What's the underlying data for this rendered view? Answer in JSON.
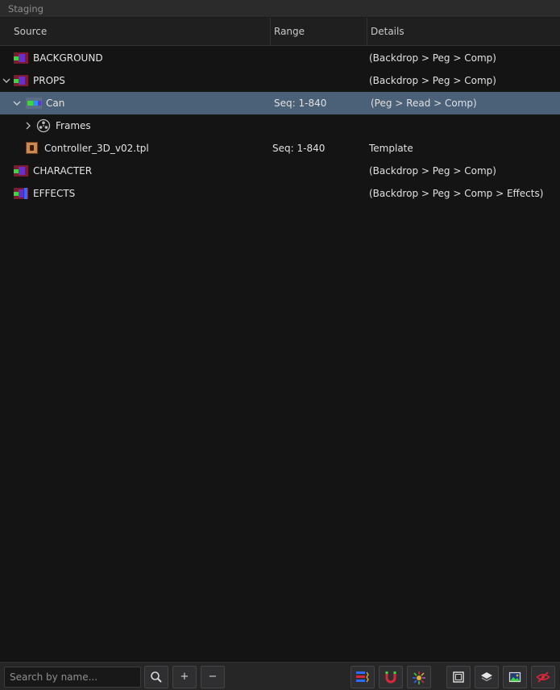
{
  "panel": {
    "title": "Staging"
  },
  "columns": {
    "source": "Source",
    "range": "Range",
    "details": "Details"
  },
  "rows": [
    {
      "name": "BACKGROUND",
      "range": "",
      "details": "(Backdrop > Peg > Comp)"
    },
    {
      "name": "PROPS",
      "range": "",
      "details": "(Backdrop > Peg > Comp)"
    },
    {
      "name": "Can",
      "range": "Seq: 1-840",
      "details": "(Peg > Read > Comp)"
    },
    {
      "name": "Frames",
      "range": "",
      "details": ""
    },
    {
      "name": "Controller_3D_v02.tpl",
      "range": "Seq: 1-840",
      "details": "Template"
    },
    {
      "name": "CHARACTER",
      "range": "",
      "details": "(Backdrop > Peg > Comp)"
    },
    {
      "name": "EFFECTS",
      "range": "",
      "details": "(Backdrop > Peg > Comp > Effects)"
    }
  ],
  "footer": {
    "search_placeholder": "Search by name...",
    "add_label": "+",
    "remove_label": "−"
  },
  "icons": {
    "group": "layer-group-icon",
    "frames": "film-reel-icon",
    "template": "template-icon",
    "search": "search-icon",
    "node_colors": "node-color-icon",
    "magnet": "magnet-icon",
    "sparkle": "effects-burst-icon",
    "frame": "camera-frame-icon",
    "layers": "layers-icon",
    "image": "image-icon",
    "hide": "eye-hidden-icon"
  },
  "colors": {
    "selection": "#4b6178",
    "background": "#141415",
    "group_green": "#3fd640",
    "group_purple": "#6b2fc9",
    "group_red": "#7d1a2e",
    "effects_blue": "#2d6cff",
    "hide_red": "#d8283a"
  }
}
